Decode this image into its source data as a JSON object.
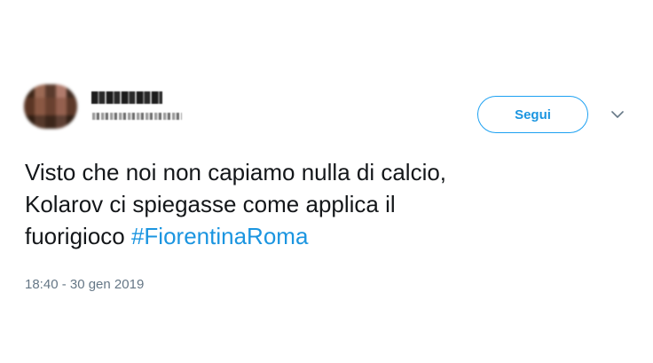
{
  "user": {
    "display_name": "",
    "handle": ""
  },
  "follow_button": {
    "label": "Segui"
  },
  "tweet": {
    "line1": "Visto che noi non capiamo nulla di calcio,",
    "line2": "Kolarov ci spiegasse come applica il",
    "line3_text": "fuorigioco ",
    "hashtag": "#FiorentinaRoma"
  },
  "timestamp": "18:40 - 30 gen 2019",
  "colors": {
    "accent": "#1da1f2",
    "link": "#1b95e0",
    "text": "#14171a",
    "muted": "#657786"
  },
  "icons": [
    "chevron-down-icon"
  ]
}
